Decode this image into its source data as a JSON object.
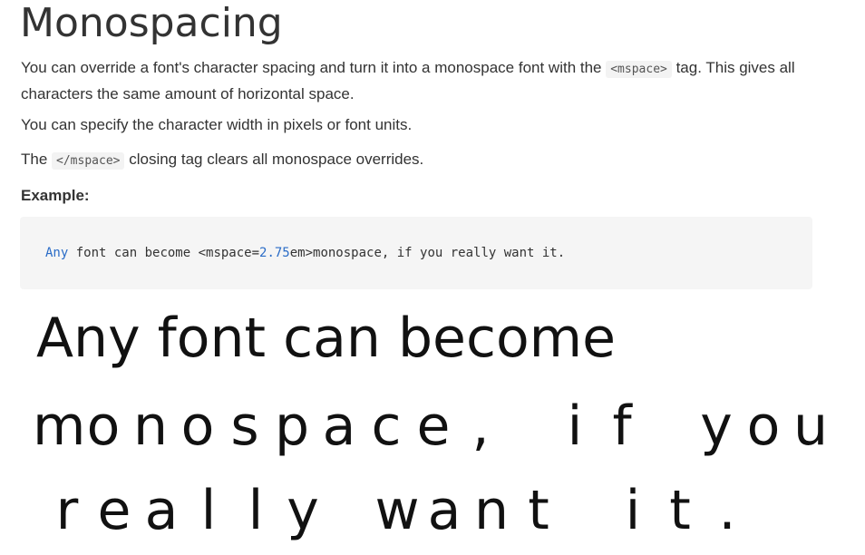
{
  "header": {
    "title": "Monospacing"
  },
  "paragraphs": {
    "p1_before": "You can override a font's character spacing and turn it into a monospace font with the ",
    "p1_code": "<mspace>",
    "p1_after": " tag. This gives all characters the same amount of horizontal space.",
    "p2": "You can specify the character width in pixels or font units.",
    "p3_before": "The ",
    "p3_code": "</mspace>",
    "p3_after": " closing tag clears all monospace overrides."
  },
  "example": {
    "label": "Example:",
    "code_kw": "Any",
    "code_mid1": " font can become <mspace=",
    "code_num": "2.75",
    "code_mid2": "em>monospace, if you really want it."
  },
  "demo": {
    "line1": "Any font can become",
    "line2": "monospace, if you",
    "line3": "really want it."
  },
  "colors": {
    "text": "#333333",
    "code_bg": "#f5f5f5",
    "keyword": "#2a6cc7"
  }
}
